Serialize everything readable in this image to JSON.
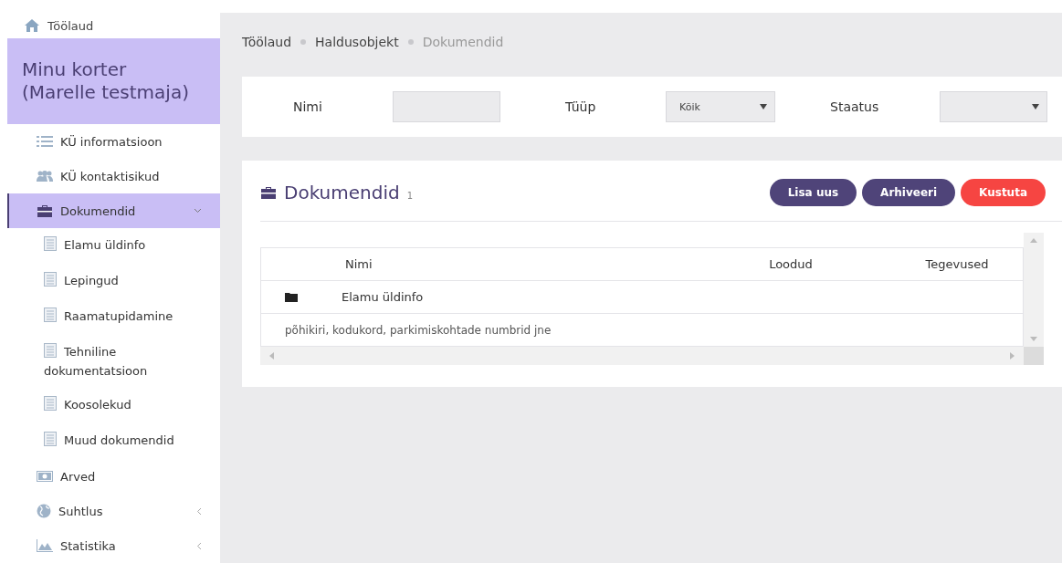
{
  "sidebar": {
    "home": {
      "label": "Töölaud"
    },
    "title": "Minu korter (Marelle testmaja)",
    "items": [
      {
        "label": "KÜ informatsioon",
        "selected": false
      },
      {
        "label": "KÜ kontaktisikud",
        "selected": false
      },
      {
        "label": "Dokumendid",
        "selected": true,
        "expanded": true,
        "children": [
          {
            "label": "Elamu üldinfo",
            "selected": false
          },
          {
            "label": "Lepingud",
            "selected": false
          },
          {
            "label": "Raamatupidamine",
            "selected": false
          },
          {
            "label": "Tehniline dokumentatsioon",
            "selected": false
          },
          {
            "label": "Koosolekud",
            "selected": false
          },
          {
            "label": "Muud dokumendid",
            "selected": false
          }
        ]
      },
      {
        "label": "Arved",
        "selected": false
      },
      {
        "label": "Suhtlus",
        "selected": false,
        "expanded": false
      },
      {
        "label": "Statistika",
        "selected": false,
        "expanded": false
      }
    ]
  },
  "breadcrumb": [
    {
      "label": "Töölaud",
      "current": false
    },
    {
      "label": "Haldusobjekt",
      "current": false
    },
    {
      "label": "Dokumendid",
      "current": true
    }
  ],
  "filters": [
    {
      "kind": "input",
      "label": "Nimi"
    },
    {
      "kind": "select",
      "label": "Tüüp",
      "value": "Kõik"
    },
    {
      "kind": "select",
      "label": "Staatus"
    }
  ],
  "panel": {
    "title": "Dokumendid",
    "count": "1",
    "buttons": [
      {
        "label": "Lisa uus",
        "kind": "primary"
      },
      {
        "label": "Arhiveeri",
        "kind": "primary"
      },
      {
        "label": "Kustuta",
        "kind": "danger"
      }
    ],
    "table": {
      "columns": [
        "Nimi",
        "Loodud",
        "Tegevused"
      ],
      "rows": [
        {
          "name": "Elamu üldinfo",
          "description": "põhikiri, kodukord, parkimiskohtade numbrid jne"
        }
      ]
    }
  }
}
